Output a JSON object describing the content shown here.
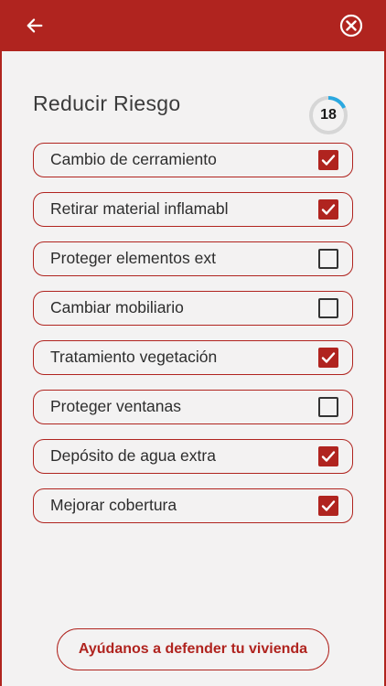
{
  "header": {
    "back_icon": "arrow-left-icon",
    "close_icon": "close-circle-icon",
    "background_color": "#b0241f"
  },
  "main": {
    "title": "Reducir Riesgo",
    "counter": {
      "value": "18",
      "progress_fraction": 0.18,
      "progress_color": "#2aa8e0",
      "track_color": "#d6d6d6"
    },
    "items": [
      {
        "label": "Cambio de cerramiento",
        "checked": true
      },
      {
        "label": "Retirar material inflamabl",
        "checked": true
      },
      {
        "label": "Proteger elementos ext",
        "checked": false
      },
      {
        "label": "Cambiar mobiliario",
        "checked": false
      },
      {
        "label": "Tratamiento vegetación",
        "checked": true
      },
      {
        "label": "Proteger ventanas",
        "checked": false
      },
      {
        "label": "Depósito de agua extra",
        "checked": true
      },
      {
        "label": "Mejorar cobertura",
        "checked": true
      }
    ],
    "cta_label": "Ayúdanos a defender tu vivienda"
  },
  "colors": {
    "accent": "#b0241f",
    "background": "#f3f2f2",
    "text": "#2d2d2d"
  }
}
